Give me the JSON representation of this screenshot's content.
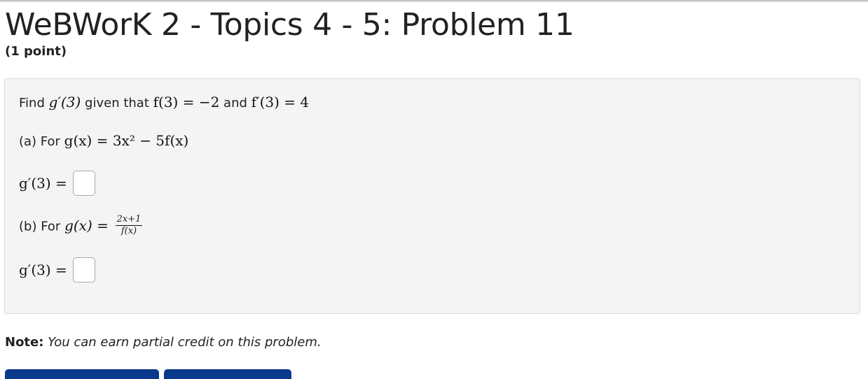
{
  "header": {
    "title": "WeBWorK 2 - Topics 4 - 5: Problem 11",
    "points": "(1 point)"
  },
  "problem": {
    "intro_prefix": "Find",
    "intro_g": "g′(3)",
    "intro_given": "given that",
    "intro_f": "f(3) = −2",
    "intro_and": "and",
    "intro_fp": "f′(3) = 4",
    "part_a_label": "(a) For",
    "part_a_expr": "g(x) = 3x² − 5f(x)",
    "part_b_label": "(b) For",
    "part_b_lhs": "g(x) =",
    "part_b_num": "2x+1",
    "part_b_den": "f(x)",
    "answer_label": "g′(3) ="
  },
  "answers": {
    "a": "",
    "b": ""
  },
  "note": {
    "label": "Note:",
    "text": "You can earn partial credit on this problem."
  },
  "colors": {
    "box_bg": "#f4f4f4",
    "button": "#0b3a8c"
  }
}
